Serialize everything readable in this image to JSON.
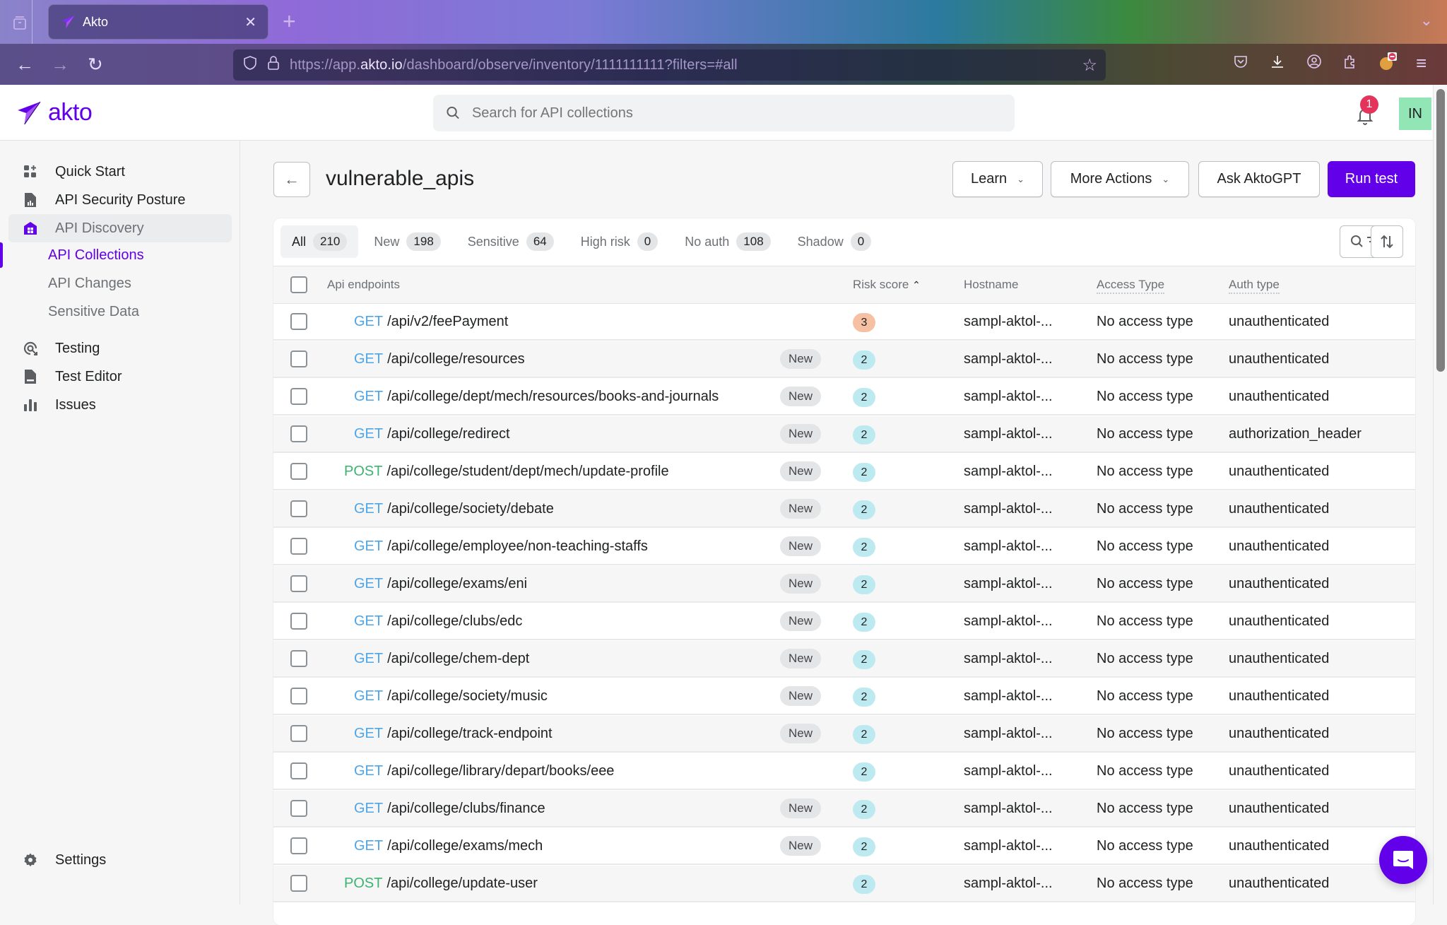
{
  "browser": {
    "tab_title": "Akto",
    "url_prefix": "https://app.",
    "url_domain": "akto.io",
    "url_path": "/dashboard/observe/inventory/1111111111?filters=#all"
  },
  "header": {
    "logo_text": "akto",
    "search_placeholder": "Search for API collections",
    "notification_count": "1",
    "avatar_initials": "IN"
  },
  "sidebar": {
    "items": [
      {
        "label": "Quick Start",
        "icon": "quick-start-icon"
      },
      {
        "label": "API Security Posture",
        "icon": "report-icon"
      },
      {
        "label": "API Discovery",
        "icon": "inventory-icon"
      },
      {
        "label": "Testing",
        "icon": "testing-icon"
      },
      {
        "label": "Test Editor",
        "icon": "file-icon"
      },
      {
        "label": "Issues",
        "icon": "bar-chart-icon"
      }
    ],
    "sub_items": [
      {
        "label": "API Collections",
        "selected": true
      },
      {
        "label": "API Changes",
        "selected": false
      },
      {
        "label": "Sensitive Data",
        "selected": false
      }
    ],
    "settings_label": "Settings"
  },
  "page": {
    "title": "vulnerable_apis",
    "buttons": {
      "learn": "Learn",
      "more_actions": "More Actions",
      "ask_gpt": "Ask AktoGPT",
      "run_test": "Run test"
    },
    "tabs": [
      {
        "label": "All",
        "count": "210",
        "active": true
      },
      {
        "label": "New",
        "count": "198",
        "active": false
      },
      {
        "label": "Sensitive",
        "count": "64",
        "active": false
      },
      {
        "label": "High risk",
        "count": "0",
        "active": false
      },
      {
        "label": "No auth",
        "count": "108",
        "active": false
      },
      {
        "label": "Shadow",
        "count": "0",
        "active": false
      }
    ]
  },
  "table": {
    "columns": {
      "endpoint": "Api endpoints",
      "risk": "Risk score",
      "hostname": "Hostname",
      "access": "Access Type",
      "auth": "Auth type"
    },
    "new_label": "New",
    "rows": [
      {
        "method": "GET",
        "path": "/api/v2/feePayment",
        "new": false,
        "risk": "3",
        "host": "sampl-aktol-...",
        "access": "No access type",
        "auth": "unauthenticated"
      },
      {
        "method": "GET",
        "path": "/api/college/resources",
        "new": true,
        "risk": "2",
        "host": "sampl-aktol-...",
        "access": "No access type",
        "auth": "unauthenticated"
      },
      {
        "method": "GET",
        "path": "/api/college/dept/mech/resources/books-and-journals",
        "new": true,
        "risk": "2",
        "host": "sampl-aktol-...",
        "access": "No access type",
        "auth": "unauthenticated"
      },
      {
        "method": "GET",
        "path": "/api/college/redirect",
        "new": true,
        "risk": "2",
        "host": "sampl-aktol-...",
        "access": "No access type",
        "auth": "authorization_header"
      },
      {
        "method": "POST",
        "path": "/api/college/student/dept/mech/update-profile",
        "new": true,
        "risk": "2",
        "host": "sampl-aktol-...",
        "access": "No access type",
        "auth": "unauthenticated"
      },
      {
        "method": "GET",
        "path": "/api/college/society/debate",
        "new": true,
        "risk": "2",
        "host": "sampl-aktol-...",
        "access": "No access type",
        "auth": "unauthenticated"
      },
      {
        "method": "GET",
        "path": "/api/college/employee/non-teaching-staffs",
        "new": true,
        "risk": "2",
        "host": "sampl-aktol-...",
        "access": "No access type",
        "auth": "unauthenticated"
      },
      {
        "method": "GET",
        "path": "/api/college/exams/eni",
        "new": true,
        "risk": "2",
        "host": "sampl-aktol-...",
        "access": "No access type",
        "auth": "unauthenticated"
      },
      {
        "method": "GET",
        "path": "/api/college/clubs/edc",
        "new": true,
        "risk": "2",
        "host": "sampl-aktol-...",
        "access": "No access type",
        "auth": "unauthenticated"
      },
      {
        "method": "GET",
        "path": "/api/college/chem-dept",
        "new": true,
        "risk": "2",
        "host": "sampl-aktol-...",
        "access": "No access type",
        "auth": "unauthenticated"
      },
      {
        "method": "GET",
        "path": "/api/college/society/music",
        "new": true,
        "risk": "2",
        "host": "sampl-aktol-...",
        "access": "No access type",
        "auth": "unauthenticated"
      },
      {
        "method": "GET",
        "path": "/api/college/track-endpoint",
        "new": true,
        "risk": "2",
        "host": "sampl-aktol-...",
        "access": "No access type",
        "auth": "unauthenticated"
      },
      {
        "method": "GET",
        "path": "/api/college/library/depart/books/eee",
        "new": false,
        "risk": "2",
        "host": "sampl-aktol-...",
        "access": "No access type",
        "auth": "unauthenticated"
      },
      {
        "method": "GET",
        "path": "/api/college/clubs/finance",
        "new": true,
        "risk": "2",
        "host": "sampl-aktol-...",
        "access": "No access type",
        "auth": "unauthenticated"
      },
      {
        "method": "GET",
        "path": "/api/college/exams/mech",
        "new": true,
        "risk": "2",
        "host": "sampl-aktol-...",
        "access": "No access type",
        "auth": "unauthenticated"
      },
      {
        "method": "POST",
        "path": "/api/college/update-user",
        "new": false,
        "risk": "2",
        "host": "sampl-aktol-...",
        "access": "No access type",
        "auth": "unauthenticated"
      }
    ]
  },
  "colors": {
    "brand": "#6200ea",
    "get_method": "#4ea5e8",
    "post_method": "#3cb371",
    "risk_high": "#f5c1a2",
    "risk_medium": "#bdeaf0"
  }
}
